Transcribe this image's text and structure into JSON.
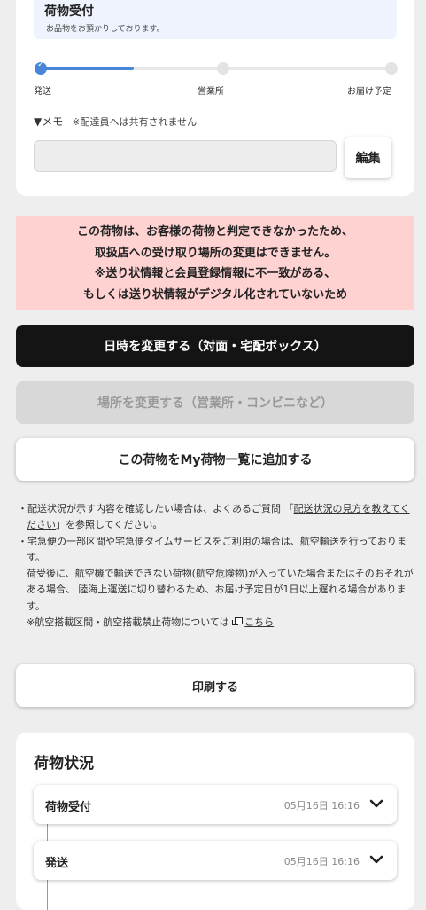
{
  "status_box": {
    "title": "荷物受付",
    "subtitle": "お品物をお預かりしております。"
  },
  "progress": {
    "fraction": 0.27,
    "steps": [
      "発送",
      "営業所",
      "お届け予定"
    ],
    "accent_color": "#4a86d8"
  },
  "memo": {
    "label": "▼メモ",
    "note": "※配達員へは共有されません",
    "value": "",
    "edit_label": "編集"
  },
  "alert": {
    "lines": [
      "この荷物は、お客様の荷物と判定できなかったため、",
      "取扱店への受け取り場所の変更はできません。",
      "※送り状情報と会員登録情報に不一致がある、",
      "もしくは送り状情報がデジタル化されていないため"
    ],
    "bg_color": "#ffd2d2"
  },
  "buttons": {
    "change_datetime": "日時を変更する（対面・宅配ボックス）",
    "change_place": "場所を変更する（営業所・コンビニなど）",
    "add_to_list": "この荷物をMy荷物一覧に追加する",
    "print": "印刷する"
  },
  "notes": {
    "n1_prefix": "・配送状況が示す内容を確認したい場合は、よくあるご質問 「",
    "n1_link": "配送状況の見方を教えてください",
    "n1_suffix": "」を参照してください。",
    "n2_line1": "・宅急便の一部区間や宅急便タイムサービスをご利用の場合は、航空輸送を行っております。",
    "n2_line2": "荷受後に、航空機で輸送できない荷物(航空危険物)が入っていた場合またはそのおそれがある場合、 陸海上運送に切り替わるため、お届け予定日が1日以上遅れる場合があります。",
    "n3_prefix": "※航空搭載区間・航空搭載禁止荷物については",
    "n3_link": "こちら"
  },
  "history": {
    "title": "荷物状況",
    "items": [
      {
        "label": "荷物受付",
        "date": "05月16日 16:16"
      },
      {
        "label": "発送",
        "date": "05月16日 16:16"
      }
    ]
  }
}
